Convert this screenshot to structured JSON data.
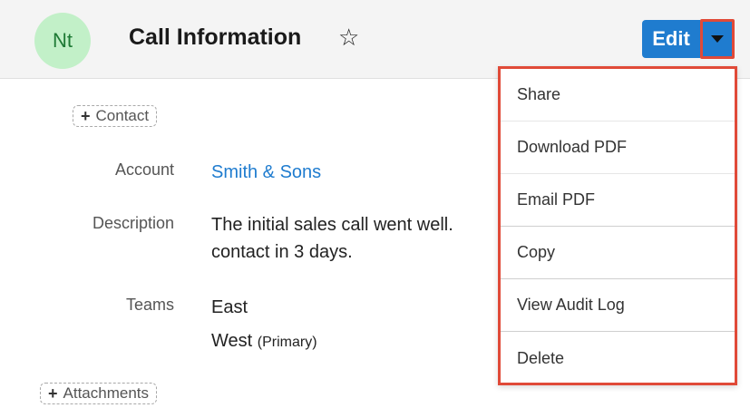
{
  "header": {
    "avatar_initials": "Nt",
    "title": "Call Information",
    "star_icon": "star-outline-icon",
    "edit_label": "Edit",
    "caret_icon": "caret-down-icon"
  },
  "fields": {
    "contact_pill": "Contact",
    "account_label": "Account",
    "account_value": "Smith & Sons",
    "description_label": "Description",
    "description_line1": "The initial sales call went well.",
    "description_line2": "contact in 3 days.",
    "teams_label": "Teams",
    "team1": "East",
    "team2": "West",
    "team2_tag": "(Primary)",
    "attachments_pill": "Attachments"
  },
  "menu": {
    "items": [
      {
        "label": "Share"
      },
      {
        "label": "Download PDF"
      },
      {
        "label": "Email PDF"
      },
      {
        "label": "Copy"
      },
      {
        "label": "View Audit Log"
      },
      {
        "label": "Delete"
      }
    ]
  },
  "colors": {
    "accent": "#1f7ccf",
    "highlight": "#e04a38",
    "avatar_bg": "#c2f0c8"
  }
}
